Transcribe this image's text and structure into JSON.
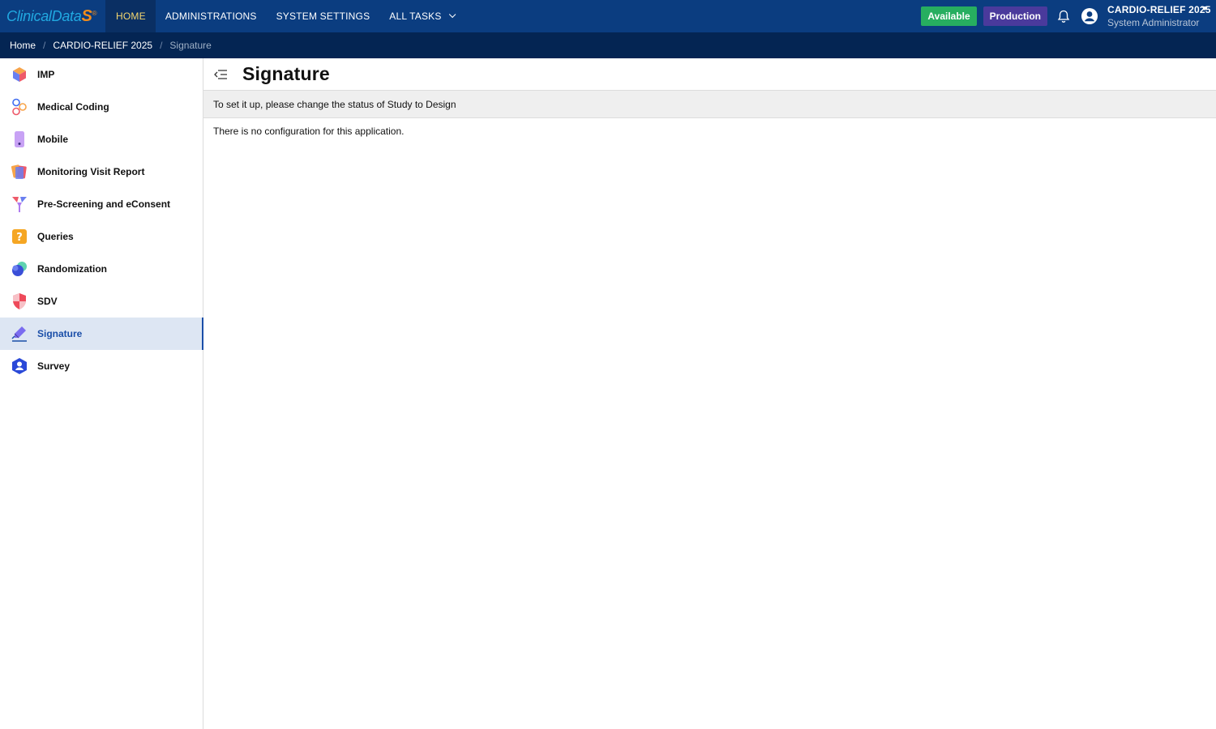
{
  "brand": {
    "logo_text": "ClinicalData",
    "logo_mark": "S"
  },
  "nav": {
    "items": [
      {
        "label": "HOME",
        "active": true
      },
      {
        "label": "ADMINISTRATIONS",
        "active": false
      },
      {
        "label": "SYSTEM SETTINGS",
        "active": false
      },
      {
        "label": "ALL TASKS",
        "active": false,
        "icon": "chevron-down-icon"
      }
    ]
  },
  "status": {
    "available": {
      "label": "Available",
      "color": "#27ae60"
    },
    "environment": {
      "label": "Production",
      "color": "#4a3a9c"
    }
  },
  "user": {
    "study": "CARDIO-RELIEF 2025",
    "role": "System Administrator"
  },
  "breadcrumb": [
    "Home",
    "CARDIO-RELIEF 2025",
    "Signature"
  ],
  "sidebar": {
    "items": [
      {
        "label": "IMP",
        "icon": "cube-icon"
      },
      {
        "label": "Medical Coding",
        "icon": "hexagons-icon"
      },
      {
        "label": "Mobile",
        "icon": "mobile-icon"
      },
      {
        "label": "Monitoring Visit Report",
        "icon": "cards-icon"
      },
      {
        "label": "Pre-Screening and eConsent",
        "icon": "funnel-icon"
      },
      {
        "label": "Queries",
        "icon": "question-icon"
      },
      {
        "label": "Randomization",
        "icon": "circles-icon"
      },
      {
        "label": "SDV",
        "icon": "shield-icon"
      },
      {
        "label": "Signature",
        "icon": "pen-icon",
        "active": true
      },
      {
        "label": "Survey",
        "icon": "person-hexagon-icon"
      }
    ]
  },
  "page": {
    "title": "Signature",
    "notice": "To set it up, please change the status of Study to Design",
    "empty_message": "There is no configuration for this application."
  },
  "colors": {
    "topbar": "#0b3d80",
    "breadcrumb_bar": "#042553",
    "accent": "#1a4ea8"
  }
}
